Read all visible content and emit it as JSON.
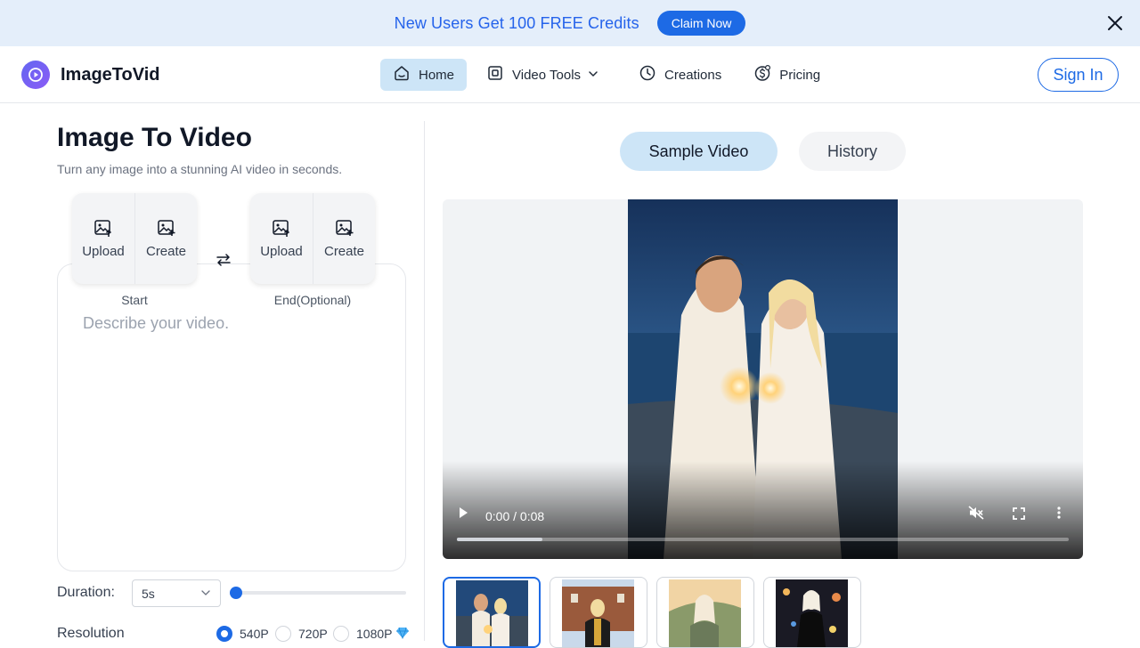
{
  "banner": {
    "text": "New Users Get 100 FREE Credits",
    "cta_label": "Claim Now"
  },
  "brand": {
    "name": "ImageToVid"
  },
  "nav": {
    "items": [
      {
        "label": "Home",
        "icon": "home-icon",
        "active": true
      },
      {
        "label": "Video Tools",
        "icon": "video-tools-icon",
        "dropdown": true
      },
      {
        "label": "Creations",
        "icon": "clock-icon"
      },
      {
        "label": "Pricing",
        "icon": "dollar-icon"
      }
    ],
    "sign_in_label": "Sign In"
  },
  "editor": {
    "title": "Image To Video",
    "subtitle": "Turn any image into a stunning AI video in seconds.",
    "start_slot": {
      "upload_label": "Upload",
      "create_label": "Create",
      "caption": "Start"
    },
    "end_slot": {
      "upload_label": "Upload",
      "create_label": "Create",
      "caption": "End(Optional)"
    },
    "prompt_placeholder": "Describe your video.",
    "prompt_value": "",
    "duration": {
      "label": "Duration:",
      "value": "5s",
      "slider_fraction": 0
    },
    "resolution": {
      "label": "Resolution",
      "options": [
        {
          "label": "540P",
          "checked": true
        },
        {
          "label": "720P",
          "checked": false
        },
        {
          "label": "1080P",
          "checked": false,
          "premium_icon": "diamond-icon"
        }
      ]
    }
  },
  "preview": {
    "tabs": [
      {
        "label": "Sample Video",
        "active": true
      },
      {
        "label": "History",
        "active": false
      }
    ],
    "player": {
      "time": "0:00 / 0:08",
      "progress_fraction": 0.14,
      "muted": true
    },
    "thumbnails": [
      {
        "scene": "couple-beach-sparklers",
        "selected": true
      },
      {
        "scene": "graduate-campus",
        "selected": false
      },
      {
        "scene": "woman-mountain-sunset",
        "selected": false
      },
      {
        "scene": "woman-black-dress-city-night",
        "selected": false
      }
    ]
  },
  "colors": {
    "accent": "#1d6ae5",
    "banner_bg": "#e4eefa",
    "active_tab_bg": "#cde5f7"
  }
}
